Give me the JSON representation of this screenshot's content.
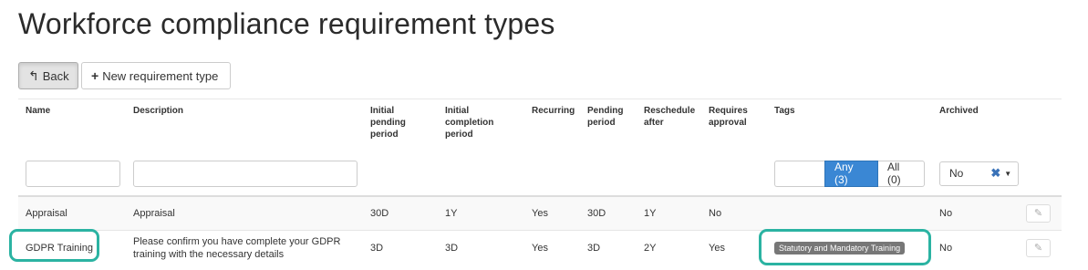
{
  "page": {
    "title": "Workforce compliance requirement types"
  },
  "toolbar": {
    "back_label": "Back",
    "new_label": "New requirement type"
  },
  "columns": {
    "name": "Name",
    "description": "Description",
    "initial_pending_period": "Initial pending period",
    "initial_completion_period": "Initial completion period",
    "recurring": "Recurring",
    "pending_period": "Pending period",
    "reschedule_after": "Reschedule after",
    "requires_approval": "Requires approval",
    "tags": "Tags",
    "archived": "Archived"
  },
  "filters": {
    "name_value": "",
    "description_value": "",
    "tags_value": "",
    "tags_any_label": "Any (3)",
    "tags_all_label": "All (0)",
    "archived_value": "No"
  },
  "rows": [
    {
      "name": "Appraisal",
      "description": "Appraisal",
      "initial_pending_period": "30D",
      "initial_completion_period": "1Y",
      "recurring": "Yes",
      "pending_period": "30D",
      "reschedule_after": "1Y",
      "requires_approval": "No",
      "tags": [],
      "archived": "No"
    },
    {
      "name": "GDPR Training",
      "description": "Please confirm you have complete your GDPR training with the necessary details",
      "initial_pending_period": "3D",
      "initial_completion_period": "3D",
      "recurring": "Yes",
      "pending_period": "3D",
      "reschedule_after": "2Y",
      "requires_approval": "Yes",
      "tags": [
        "Statutory and Mandatory Training"
      ],
      "archived": "No"
    }
  ],
  "colors": {
    "primary": "#3a87d4",
    "highlight": "#2bb3a2",
    "tag_badge": "#777777"
  }
}
